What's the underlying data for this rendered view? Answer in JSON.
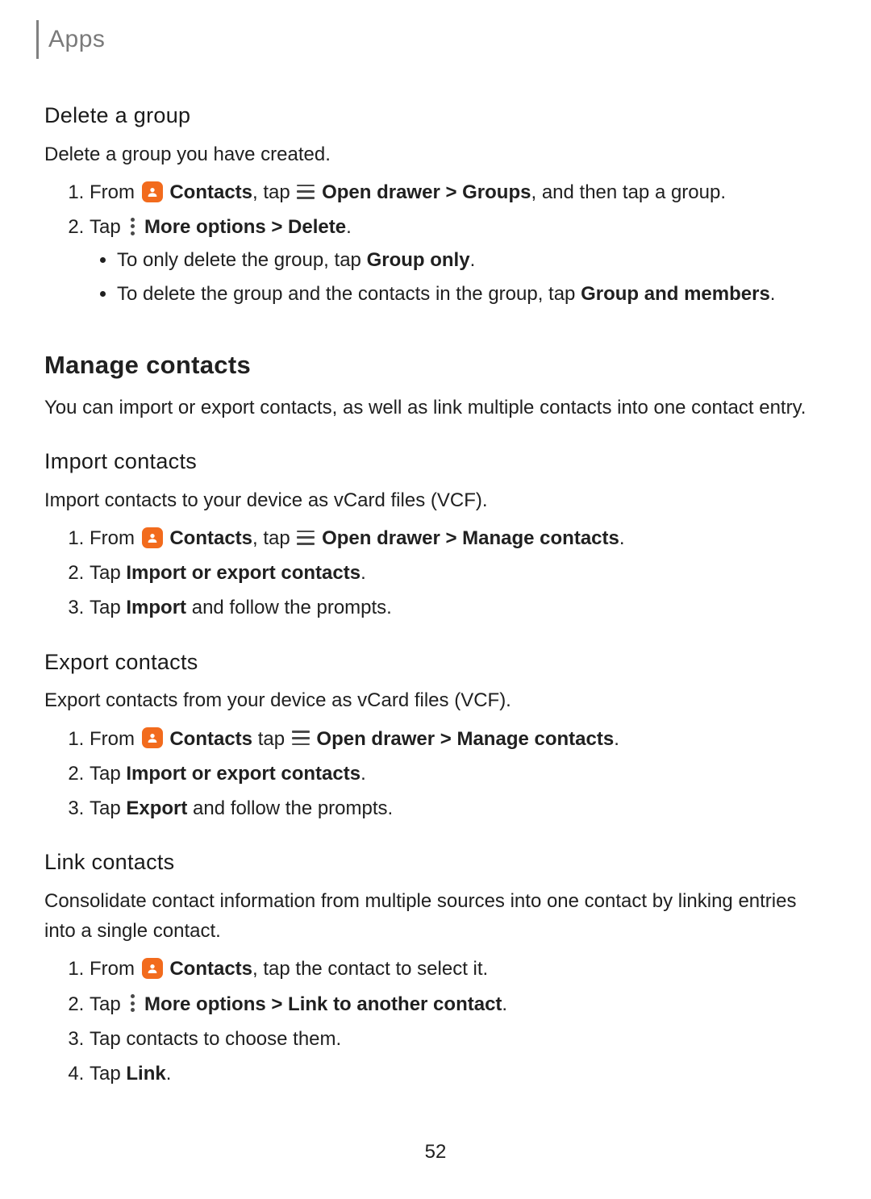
{
  "header": {
    "title": "Apps"
  },
  "page_number": "52",
  "glyphs": {
    "chevron": ">"
  },
  "delete_group": {
    "heading": "Delete a group",
    "body": "Delete a group you have created.",
    "steps": {
      "s1": {
        "t_from": "From ",
        "t_contacts": "Contacts",
        "t_tap": ", tap ",
        "t_opendrawer": "Open drawer ",
        "t_groups": " Groups",
        "t_end": ", and then tap a group."
      },
      "s2": {
        "t_tap": "Tap ",
        "t_more": "More options ",
        "t_delete": " Delete",
        "t_period": ".",
        "bullets": {
          "b1": {
            "t1": "To only delete the group, tap ",
            "t2": "Group only",
            "t3": "."
          },
          "b2": {
            "t1": "To delete the group and the contacts in the group, tap ",
            "t2": "Group and members",
            "t3": "."
          }
        }
      }
    }
  },
  "manage_contacts": {
    "heading": "Manage contacts",
    "body": "You can import or export contacts, as well as link multiple contacts into one contact entry."
  },
  "import_contacts": {
    "heading": "Import contacts",
    "body": "Import contacts to your device as vCard files (VCF).",
    "steps": {
      "s1": {
        "t_from": "From ",
        "t_contacts": "Contacts",
        "t_tap": ", tap ",
        "t_opendrawer": "Open drawer ",
        "t_manage": " Manage contacts",
        "t_period": "."
      },
      "s2": {
        "t_tap": "Tap ",
        "t_ie": "Import or export contacts",
        "t_period": "."
      },
      "s3": {
        "t_tap": "Tap ",
        "t_import": "Import",
        "t_end": " and follow the prompts."
      }
    }
  },
  "export_contacts": {
    "heading": "Export contacts",
    "body": "Export contacts from your device as vCard files (VCF).",
    "steps": {
      "s1": {
        "t_from": "From ",
        "t_contacts": "Contacts",
        "t_tap": " tap ",
        "t_opendrawer": "Open drawer ",
        "t_manage": " Manage contacts",
        "t_period": "."
      },
      "s2": {
        "t_tap": "Tap ",
        "t_ie": "Import or export contacts",
        "t_period": "."
      },
      "s3": {
        "t_tap": "Tap ",
        "t_export": "Export",
        "t_end": " and follow the prompts."
      }
    }
  },
  "link_contacts": {
    "heading": "Link contacts",
    "body": "Consolidate contact information from multiple sources into one contact by linking entries into a single contact.",
    "steps": {
      "s1": {
        "t_from": "From ",
        "t_contacts": "Contacts",
        "t_end": ", tap the contact to select it."
      },
      "s2": {
        "t_tap": "Tap ",
        "t_more": "More options ",
        "t_link": " Link to another contact",
        "t_period": "."
      },
      "s3": {
        "t": "Tap contacts to choose them."
      },
      "s4": {
        "t_tap": "Tap ",
        "t_link": "Link",
        "t_period": "."
      }
    }
  }
}
